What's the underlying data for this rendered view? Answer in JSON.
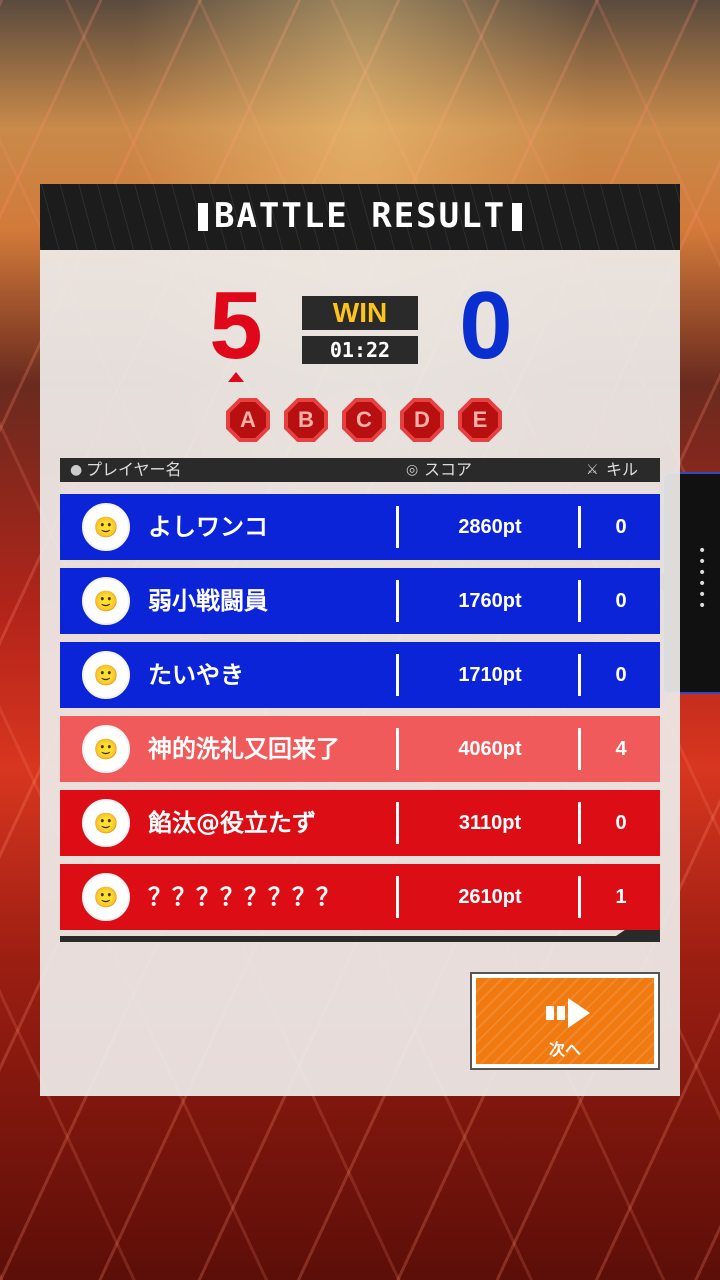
{
  "header": {
    "title": "BATTLE RESULT"
  },
  "match": {
    "red_score": "5",
    "blue_score": "0",
    "result": "WIN",
    "time": "01:22",
    "badges": [
      "A",
      "B",
      "C",
      "D",
      "E"
    ]
  },
  "columns": {
    "player": "プレイヤー名",
    "score": "スコア",
    "kills": "キル"
  },
  "players": [
    {
      "name": "よしワンコ",
      "score": "2860pt",
      "kills": "0",
      "team": "blue",
      "avatar": "avatar-icon"
    },
    {
      "name": "弱小戦闘員",
      "score": "1760pt",
      "kills": "0",
      "team": "blue",
      "avatar": "avatar-icon"
    },
    {
      "name": "たいやき",
      "score": "1710pt",
      "kills": "0",
      "team": "blue",
      "avatar": "avatar-icon"
    },
    {
      "name": "神的洗礼又回来了",
      "score": "4060pt",
      "kills": "4",
      "team": "red-self",
      "avatar": "avatar-icon"
    },
    {
      "name": "餡汰@役立たず",
      "score": "3110pt",
      "kills": "0",
      "team": "red",
      "avatar": "avatar-icon"
    },
    {
      "name": "？？？？？？？？",
      "score": "2610pt",
      "kills": "1",
      "team": "red",
      "avatar": "avatar-icon"
    }
  ],
  "next_button": {
    "label": "次へ",
    "icon": "arrow-right-icon"
  },
  "colors": {
    "red": "#dd0d16",
    "blue": "#0c24d8",
    "highlight": "#f05a5a",
    "win": "#ffc41c",
    "button": "#f07a10"
  }
}
